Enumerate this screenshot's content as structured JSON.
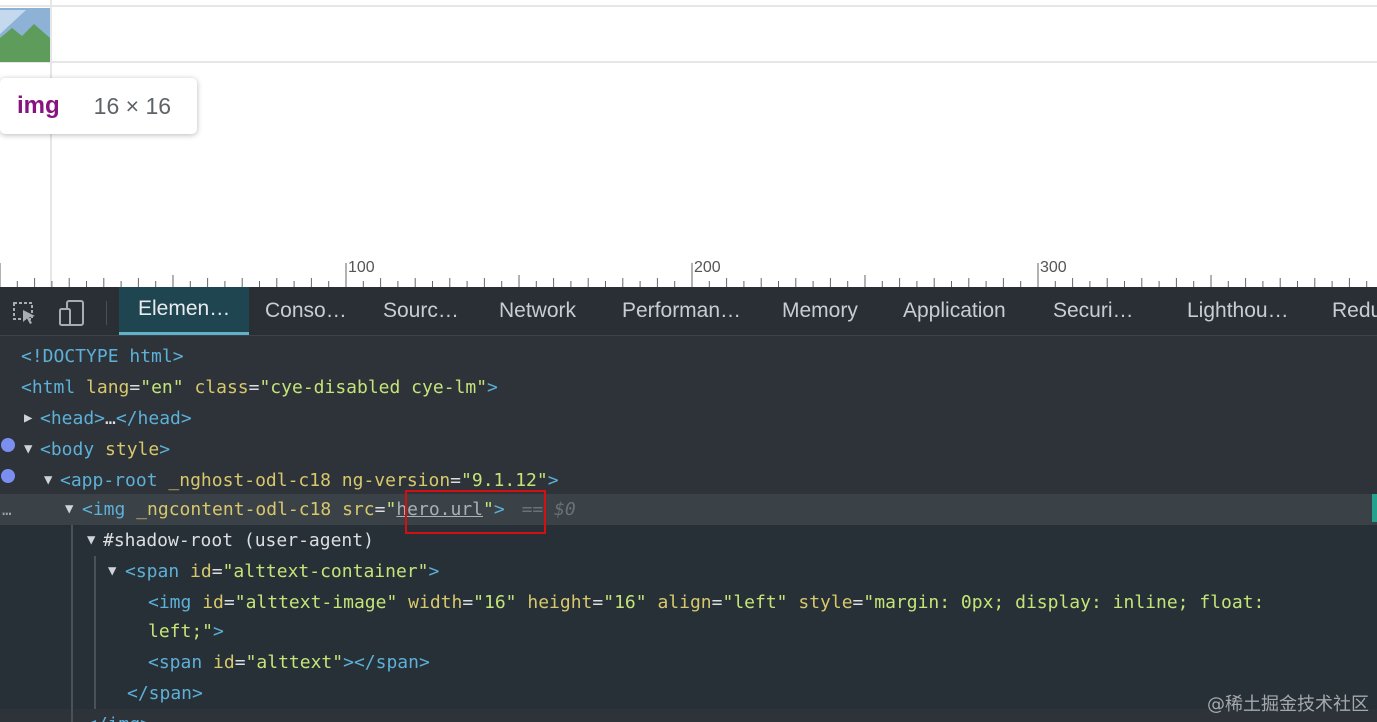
{
  "page": {
    "tooltip": {
      "tag": "img",
      "size": "16 × 16"
    },
    "ruler": {
      "labels": [
        "100",
        "200",
        "300"
      ]
    }
  },
  "toolbar": {
    "tabs": [
      {
        "label": "Elemen…",
        "active": true
      },
      {
        "label": "Conso…"
      },
      {
        "label": "Sourc…"
      },
      {
        "label": "Network"
      },
      {
        "label": "Performan…"
      },
      {
        "label": "Memory"
      },
      {
        "label": "Application"
      },
      {
        "label": "Securi…"
      },
      {
        "label": "Lighthou…"
      },
      {
        "label": "Redu"
      }
    ]
  },
  "dom": {
    "doctype": "<!DOCTYPE html>",
    "html_open": "<html",
    "html_attr_lang": "lang",
    "html_lang": "\"en\"",
    "html_attr_class": "class",
    "html_class": "\"cye-disabled cye-lm\"",
    "html_close": ">",
    "head_open": "<head>",
    "head_ellipsis": "…",
    "head_close": "</head>",
    "body_open": "<body",
    "body_attr": "style",
    "body_close": ">",
    "app_open": "<app-root",
    "app_attr_ng": "_nghost-odl-c18",
    "app_attr_ver": "ng-version",
    "app_ver": "\"9.1.12\"",
    "app_close": ">",
    "img_open": "<img",
    "img_attr_ng": "_ngcontent-odl-c18",
    "img_attr_src": "src",
    "img_src_q1": "\"",
    "img_src": "hero.url",
    "img_src_q2": "\"",
    "img_close": ">",
    "sel_marker": "== $0",
    "shadow_root": "#shadow-root (user-agent)",
    "span_open": "<span",
    "span_attr_id": "id",
    "span_id": "\"alttext-container\"",
    "span_close": ">",
    "inner_img_open": "<img",
    "inner_img_attr_id": "id",
    "inner_img_id": "\"alttext-image\"",
    "inner_img_attr_w": "width",
    "inner_img_w": "\"16\"",
    "inner_img_attr_h": "height",
    "inner_img_h": "\"16\"",
    "inner_img_attr_align": "align",
    "inner_img_align": "\"left\"",
    "inner_img_attr_style": "style",
    "inner_img_style_1": "\"margin: 0px; display: inline; float:",
    "inner_img_style_2": "left;\"",
    "inner_img_close": ">",
    "inner_span_open": "<span",
    "inner_span_attr_id": "id",
    "inner_span_id": "\"alttext\"",
    "inner_span_close": "></span>",
    "span_end": "</span>",
    "img_end": "</img>",
    "dots": "…"
  },
  "watermark": "@稀土掘金技术社区",
  "colors": {
    "selection_box": "#d40f12",
    "tooltip_tag": "#881280",
    "active_tab_underline": "#5fb2c9"
  }
}
